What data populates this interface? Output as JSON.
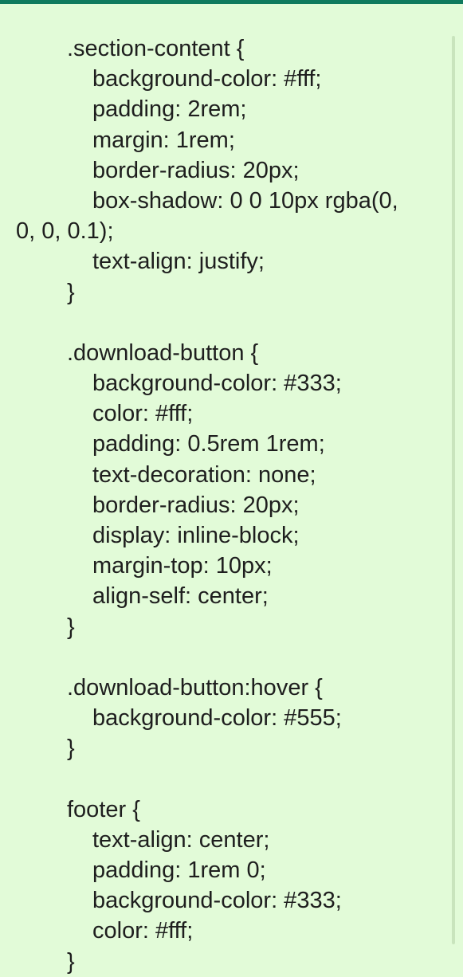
{
  "message": {
    "code_lines": [
      ".section-content {",
      "background-color: #fff;",
      "padding: 2rem;",
      "margin: 1rem;",
      "border-radius: 20px;",
      "box-shadow: 0 0 10px rgba(0,",
      "0, 0, 0.1);",
      "text-align: justify;",
      "}",
      "",
      ".download-button {",
      "background-color: #333;",
      "color: #fff;",
      "padding: 0.5rem 1rem;",
      "text-decoration: none;",
      "border-radius: 20px;",
      "display: inline-block;",
      "margin-top: 10px;",
      "align-self: center;",
      "}",
      "",
      ".download-button:hover {",
      "background-color: #555;",
      "}",
      "",
      "footer {",
      "text-align: center;",
      "padding: 1rem 0;",
      "background-color: #333;",
      "color: #fff;",
      "}"
    ]
  },
  "colors": {
    "background": "#e2fbd8",
    "accent": "#0f7a5e",
    "text": "#1e1e1e"
  }
}
